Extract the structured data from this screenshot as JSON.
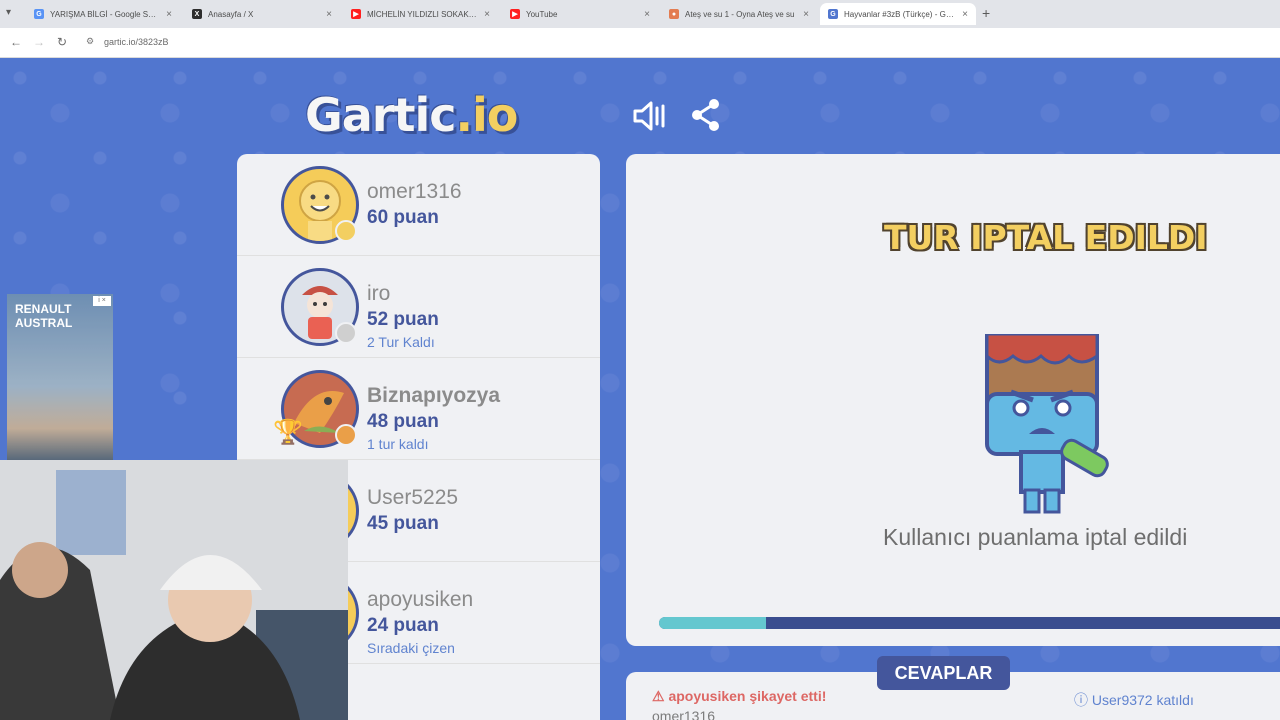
{
  "browser": {
    "tabs": [
      {
        "label": "YARIŞMA BİLGİ - Google Search",
        "icon": "google-icon",
        "color": "#4285f4"
      },
      {
        "label": "Anasayfa / X",
        "icon": "x-icon",
        "color": "#111111"
      },
      {
        "label": "MİCHELİN YILDIZLI SOKAK LEZ…",
        "icon": "youtube-icon",
        "color": "#ff0000"
      },
      {
        "label": "YouTube",
        "icon": "youtube-icon",
        "color": "#ff0000"
      },
      {
        "label": "Ateş ve su 1 - Oyna Ateş ve su",
        "icon": "game-icon",
        "color": "#e06a3a"
      },
      {
        "label": "Hayvanlar #3zB (Türkçe) - Garti…",
        "icon": "gartic-icon",
        "color": "#3a63c9"
      }
    ],
    "url": "gartic.io/3823zB"
  },
  "ad": {
    "title": "RENAULT AUSTRAL",
    "badge": "i ×"
  },
  "players": [
    {
      "name": "omer1316",
      "score": "60 puan",
      "note": "",
      "status_color": "#f2c94c",
      "avatar_color": "#f4c542"
    },
    {
      "name": "iro",
      "score": "52 puan",
      "note": "2 Tur Kaldı",
      "status_color": "#c9c9c9",
      "avatar_color": "#d9dfe8"
    },
    {
      "name": "Biznapıyozya",
      "score": "48 puan",
      "note": "1 tur kaldı",
      "status_color": "#e8922f",
      "avatar_color": "#c0573a"
    },
    {
      "name": "User5225",
      "score": "45 puan",
      "note": "",
      "status_color": "",
      "avatar_color": "#f4c542"
    },
    {
      "name": "apoyusiken",
      "score": "24 puan",
      "note": "Sıradaki çizen",
      "status_color": "",
      "avatar_color": "#f4c542"
    }
  ],
  "board": {
    "title": "TUR IPTAL EDILDI",
    "message": "Kullanıcı puanlama iptal edildi",
    "progress_fraction": 0.17
  },
  "answers": {
    "tab_label": "CEVAPLAR",
    "lines": [
      {
        "text": "⚠ apoyusiken şikayet etti!",
        "color": "#d9534f"
      },
      {
        "text": "omer1316",
        "color": "#6a6a6a"
      },
      {
        "text": "ⓘ User9372 katıldı",
        "color": "#4a72c9"
      }
    ]
  }
}
